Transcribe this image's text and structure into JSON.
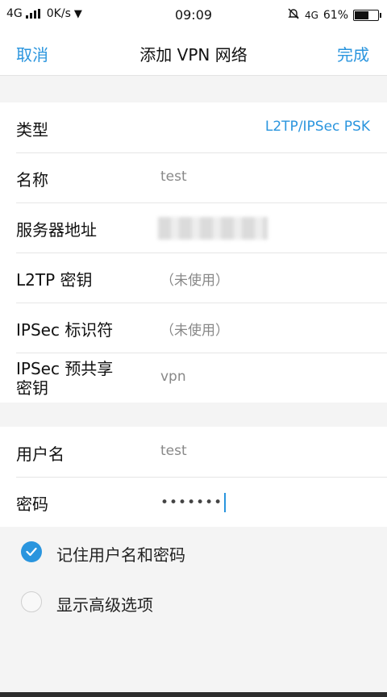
{
  "status_bar": {
    "network": "4G",
    "speed": "0K/s",
    "time": "09:09",
    "network_right": "4G",
    "battery": "61%",
    "battery_level": 0.61
  },
  "header": {
    "cancel_label": "取消",
    "title": "添加 VPN 网络",
    "done_label": "完成"
  },
  "form": {
    "type": {
      "label": "类型",
      "value": "L2TP/IPSec PSK"
    },
    "name": {
      "label": "名称",
      "value": "test"
    },
    "server": {
      "label": "服务器地址"
    },
    "l2tp_key": {
      "label": "L2TP 密钥",
      "value": "（未使用）"
    },
    "ipsec_id": {
      "label": "IPSec 标识符",
      "value": "（未使用）"
    },
    "ipsec_psk": {
      "label_line1": "IPSec 预共享",
      "label_line2": "密钥",
      "value": "vpn"
    },
    "username": {
      "label": "用户名",
      "value": "test"
    },
    "password": {
      "label": "密码",
      "value": "•••••••"
    }
  },
  "options": {
    "remember": {
      "label": "记住用户名和密码",
      "checked": true
    },
    "advanced": {
      "label": "显示高级选项",
      "checked": false
    }
  },
  "colors": {
    "accent": "#2a95de",
    "background": "#f4f4f4"
  }
}
